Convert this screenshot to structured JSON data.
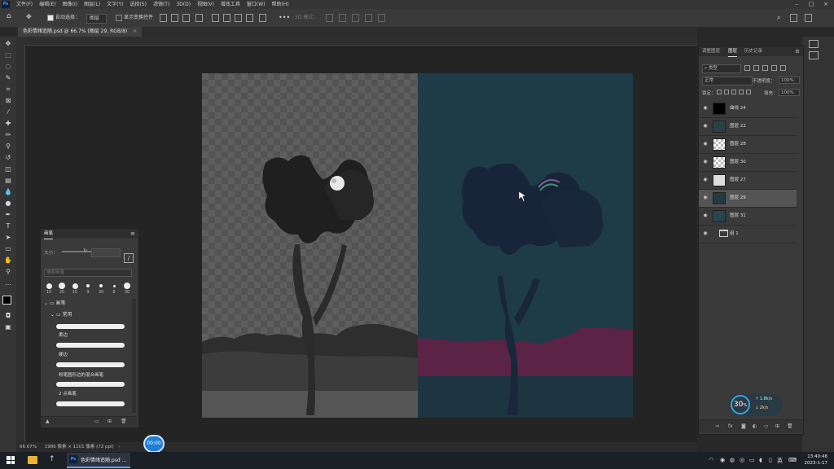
{
  "menubar": {
    "items": [
      "文件(F)",
      "编辑(E)",
      "图像(I)",
      "图层(L)",
      "文字(Y)",
      "选择(S)",
      "滤镜(T)",
      "3D(D)",
      "视图(V)",
      "增效工具",
      "窗口(W)",
      "帮助(H)"
    ],
    "window_controls": [
      "–",
      "□",
      "×"
    ]
  },
  "options_bar": {
    "auto_select_label": "自动选择：",
    "auto_select_value": "图层",
    "show_transform_label": "显示变换控件",
    "mode_label": "3D 模式："
  },
  "document": {
    "tab_title": "色彩情绪追随.psd @ 66.7% (图层 29, RGB/8)",
    "tab_close": "×"
  },
  "statusbar": {
    "zoom": "66.67%",
    "doc_info": "1986 像素 × 1101 像素 (72 ppi)"
  },
  "brush_panel": {
    "title": "画笔",
    "size_label": "大小：",
    "search_placeholder": "搜索画笔",
    "presets": [
      "15",
      "20",
      "15",
      "9",
      "30",
      "8",
      "30"
    ],
    "folder_root": "画笔",
    "folder_sub": "常用",
    "brushes": [
      "柔边",
      "硬边",
      "粉笔圆形边的混合画笔",
      "2 点画笔"
    ]
  },
  "layers_panel": {
    "tabs": [
      "调整图层",
      "图层",
      "历史记录"
    ],
    "active_tab": "图层",
    "filter_label": "类型",
    "blend_mode": "正常",
    "opacity_label": "不透明度：",
    "opacity_value": "100%",
    "lock_label": "锁定：",
    "fill_label": "填充：",
    "fill_value": "100%",
    "layers": [
      {
        "name": "曲线 24",
        "visible": true,
        "thumb": "#000000"
      },
      {
        "name": "图层 22",
        "visible": true,
        "thumb": "#2b3f4a"
      },
      {
        "name": "图层 28",
        "visible": true,
        "thumb": "checker"
      },
      {
        "name": "图层 30",
        "visible": true,
        "thumb": "checker"
      },
      {
        "name": "图层 27",
        "visible": true,
        "thumb": "#dddddd"
      },
      {
        "name": "图层 29",
        "visible": true,
        "thumb": "#223a44",
        "selected": true
      },
      {
        "name": "图层 31",
        "visible": true,
        "thumb": "#264550"
      },
      {
        "name": "组 1",
        "visible": true,
        "thumb": "folder"
      }
    ]
  },
  "widgets": {
    "cpu_percent": "30",
    "cpu_unit": "%",
    "net_up": "1.8k/s",
    "net_down": "2k/s",
    "recorder_time": "00:00"
  },
  "taskbar": {
    "app_label": "色彩情绪追随.psd ...",
    "input_method": "英",
    "clock_time": "13:40:48",
    "clock_date": "2023-1-17"
  },
  "colors": {
    "accent": "#31a8ff",
    "right_bg": "#1e3b48",
    "magenta_band": "#5b2346"
  }
}
